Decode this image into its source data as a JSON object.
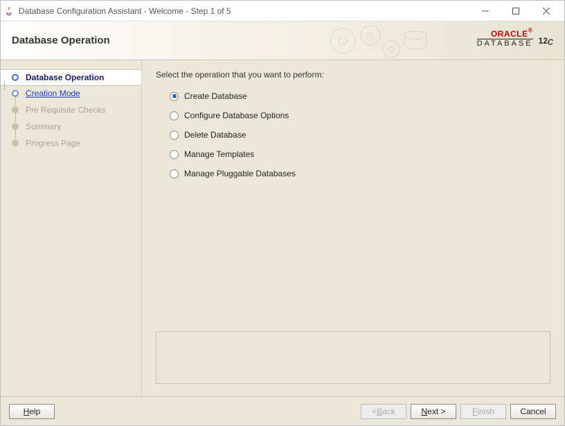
{
  "window": {
    "title": "Database Configuration Assistant - Welcome - Step 1 of 5"
  },
  "header": {
    "title": "Database Operation",
    "brand_top": "ORACLE",
    "brand_bottom": "DATABASE",
    "brand_version": "12",
    "brand_suffix": "c"
  },
  "sidebar": {
    "steps": [
      {
        "label": "Database Operation",
        "state": "current"
      },
      {
        "label": "Creation Mode",
        "state": "link"
      },
      {
        "label": "Pre Requisite Checks",
        "state": "disabled"
      },
      {
        "label": "Summary",
        "state": "disabled"
      },
      {
        "label": "Progress Page",
        "state": "disabled"
      }
    ]
  },
  "content": {
    "instruction": "Select the operation that you want to perform:",
    "options": [
      {
        "label": "Create Database",
        "selected": true
      },
      {
        "label": "Configure Database Options",
        "selected": false
      },
      {
        "label": "Delete Database",
        "selected": false
      },
      {
        "label": "Manage Templates",
        "selected": false
      },
      {
        "label": "Manage Pluggable Databases",
        "selected": false
      }
    ]
  },
  "footer": {
    "help": "Help",
    "back": "Back",
    "next": "Next",
    "finish": "Finish",
    "cancel": "Cancel"
  }
}
